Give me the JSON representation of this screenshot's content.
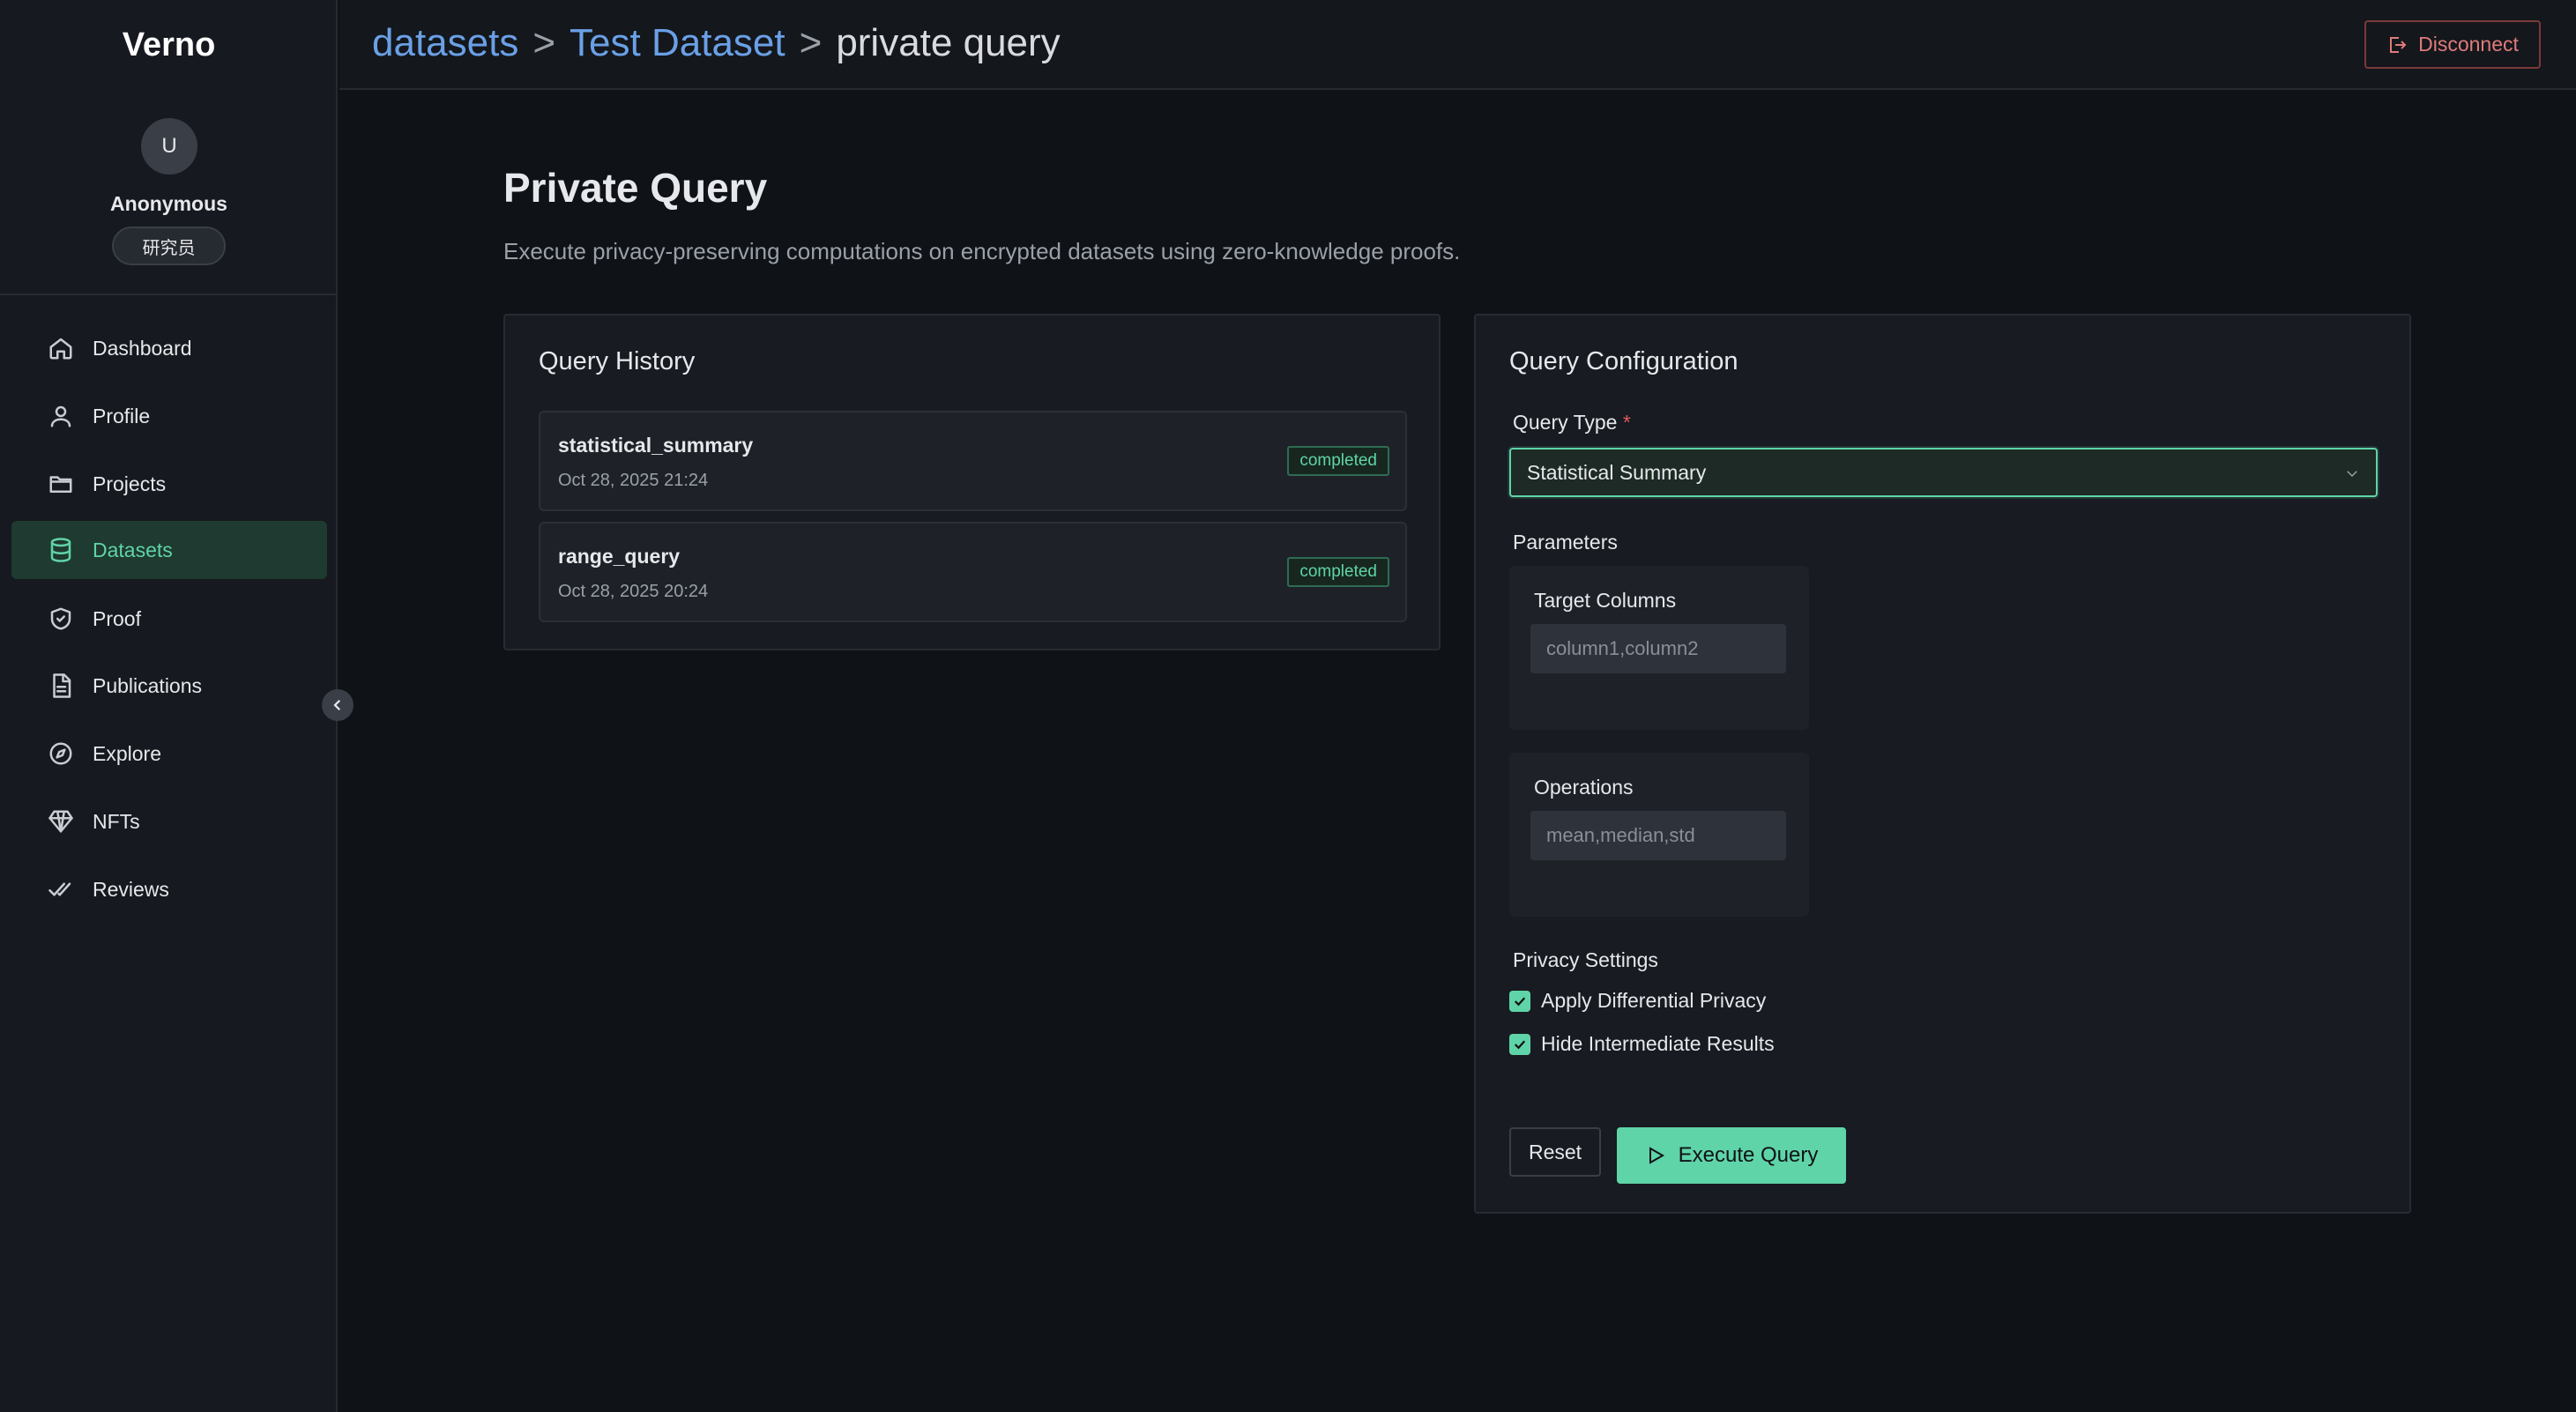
{
  "app": {
    "brand": "Verno"
  },
  "user": {
    "avatar_initial": "U",
    "name": "Anonymous",
    "role": "研究员"
  },
  "sidebar": {
    "items": [
      {
        "label": "Dashboard",
        "icon": "home-icon",
        "active": false
      },
      {
        "label": "Profile",
        "icon": "user-icon",
        "active": false
      },
      {
        "label": "Projects",
        "icon": "folder-icon",
        "active": false
      },
      {
        "label": "Datasets",
        "icon": "database-icon",
        "active": true
      },
      {
        "label": "Proof",
        "icon": "shield-icon",
        "active": false
      },
      {
        "label": "Publications",
        "icon": "document-icon",
        "active": false
      },
      {
        "label": "Explore",
        "icon": "compass-icon",
        "active": false
      },
      {
        "label": "NFTs",
        "icon": "gem-icon",
        "active": false
      },
      {
        "label": "Reviews",
        "icon": "double-check-icon",
        "active": false
      }
    ]
  },
  "header": {
    "breadcrumb": [
      {
        "label": "datasets",
        "link": true
      },
      {
        "label": "Test Dataset",
        "link": true
      },
      {
        "label": "private query",
        "link": false
      }
    ],
    "separator": ">",
    "disconnect_label": "Disconnect"
  },
  "page": {
    "title": "Private Query",
    "subtitle": "Execute privacy-preserving computations on encrypted datasets using zero-knowledge proofs."
  },
  "history": {
    "title": "Query History",
    "items": [
      {
        "name": "statistical_summary",
        "date": "Oct 28, 2025 21:24",
        "status": "completed"
      },
      {
        "name": "range_query",
        "date": "Oct 28, 2025 20:24",
        "status": "completed"
      }
    ]
  },
  "config": {
    "title": "Query Configuration",
    "query_type_label": "Query Type",
    "required_mark": "*",
    "query_type_value": "Statistical Summary",
    "parameters_label": "Parameters",
    "params": [
      {
        "label": "Target Columns",
        "placeholder": "column1,column2"
      },
      {
        "label": "Operations",
        "placeholder": "mean,median,std"
      }
    ],
    "privacy_label": "Privacy Settings",
    "privacy_options": [
      {
        "label": "Apply Differential Privacy",
        "checked": true
      },
      {
        "label": "Hide Intermediate Results",
        "checked": true
      }
    ],
    "reset_label": "Reset",
    "execute_label": "Execute Query"
  },
  "colors": {
    "accent": "#5fd4a8",
    "link": "#6aa0e6",
    "danger": "#e07b7b",
    "background": "#0f1217"
  }
}
